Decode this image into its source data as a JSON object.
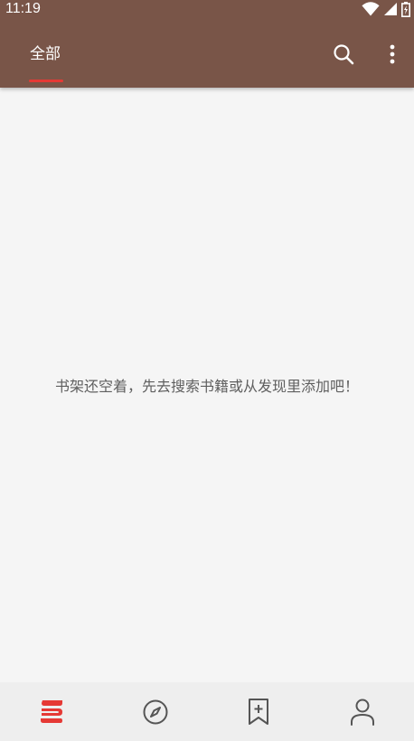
{
  "status_bar": {
    "time": "11:19",
    "icons": [
      "wifi-icon",
      "signal-icon",
      "battery-icon"
    ]
  },
  "toolbar": {
    "tabs": [
      {
        "label": "全部",
        "active": true
      }
    ],
    "actions": [
      "search-icon",
      "more-vert-icon"
    ]
  },
  "bookshelf": {
    "empty_message": "书架还空着，先去搜索书籍或从发现里添加吧！"
  },
  "bottom_nav": {
    "items": [
      {
        "icon": "bookshelf-icon",
        "active": true
      },
      {
        "icon": "compass-icon",
        "active": false
      },
      {
        "icon": "bookmark-add-icon",
        "active": false
      },
      {
        "icon": "person-icon",
        "active": false
      }
    ]
  },
  "colors": {
    "primary": "#795548",
    "accent": "#e53935",
    "background": "#f5f5f5",
    "nav_background": "#eeeeee",
    "icon_gray": "#555555"
  }
}
